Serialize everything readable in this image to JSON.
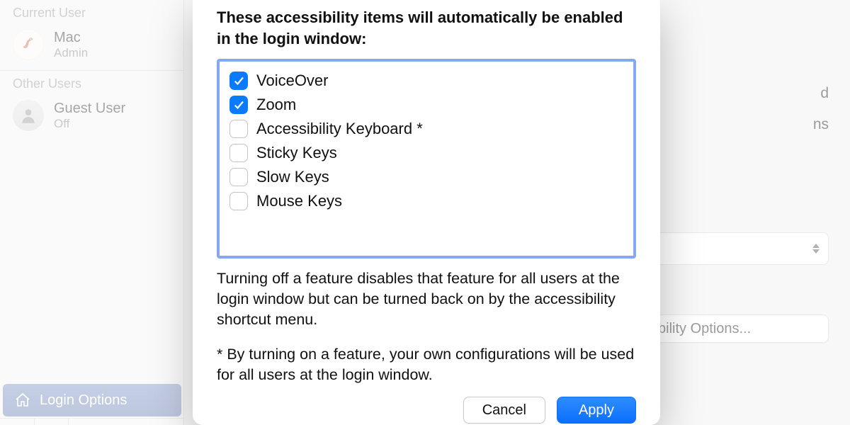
{
  "sidebar": {
    "sections": {
      "current_label": "Current User",
      "other_label": "Other Users"
    },
    "current_user": {
      "name": "Mac",
      "role": "Admin"
    },
    "other_user": {
      "name": "Guest User",
      "status": "Off"
    },
    "login_options_label": "Login Options"
  },
  "background": {
    "row2_text": "ns",
    "select_tail_text": "d",
    "button_tail": "bility Options..."
  },
  "sheet": {
    "heading": "These accessibility items will automatically be enabled in the login window:",
    "options": [
      {
        "label": "VoiceOver",
        "checked": true
      },
      {
        "label": "Zoom",
        "checked": true
      },
      {
        "label": "Accessibility Keyboard *",
        "checked": false
      },
      {
        "label": "Sticky Keys",
        "checked": false
      },
      {
        "label": "Slow Keys",
        "checked": false
      },
      {
        "label": "Mouse Keys",
        "checked": false
      }
    ],
    "explain": "Turning off a feature disables that feature for all users at the login window but can be turned back on by the accessibility shortcut menu.",
    "footnote": "* By turning on a feature, your own configurations will be used for all users at the login window.",
    "cancel_label": "Cancel",
    "apply_label": "Apply"
  }
}
